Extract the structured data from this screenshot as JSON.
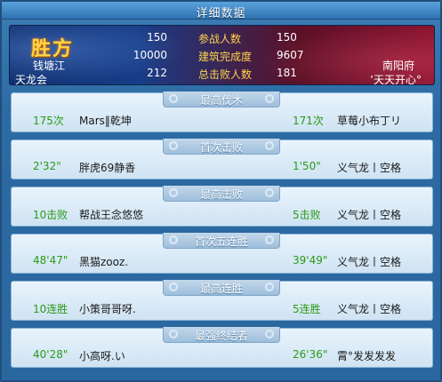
{
  "window": {
    "title": "详细数据",
    "close_label": "×"
  },
  "banner": {
    "winner_label": "胜方",
    "left": {
      "server": "钱塘江",
      "guild": "天龙会"
    },
    "right": {
      "server": "南阳府",
      "guild": "ʼ天天开心°"
    },
    "stats": [
      {
        "label": "参战人数",
        "left": "150",
        "right": "150"
      },
      {
        "label": "建筑完成度",
        "left": "10000",
        "right": "9607"
      },
      {
        "label": "总击败人数",
        "left": "212",
        "right": "181"
      }
    ]
  },
  "sections": [
    {
      "title": "最高伐木",
      "left_value": "175次",
      "left_name": "Mars‖乾坤",
      "right_value": "171次",
      "right_name": "草莓小布丁リ"
    },
    {
      "title": "首次击败",
      "left_value": "2'32\"",
      "left_name": "胖虎69静香",
      "right_value": "1'50\"",
      "right_name": "义气龙丨空格"
    },
    {
      "title": "最高击败",
      "left_value": "10击败",
      "left_name": "帮战王念悠悠",
      "right_value": "5击败",
      "right_name": "义气龙丨空格"
    },
    {
      "title": "首次五连胜",
      "left_value": "48'47\"",
      "left_name": "黑猫zooz.",
      "right_value": "39'49\"",
      "right_name": "义气龙丨空格"
    },
    {
      "title": "最高连胜",
      "left_value": "10连胜",
      "left_name": "小策哥哥呀.",
      "right_value": "5连胜",
      "right_name": "义气龙丨空格"
    },
    {
      "title": "最强终结者",
      "left_value": "40'28\"",
      "left_name": "小高呀.い",
      "right_value": "26'36\"",
      "right_name": "霄°发发发发"
    }
  ]
}
